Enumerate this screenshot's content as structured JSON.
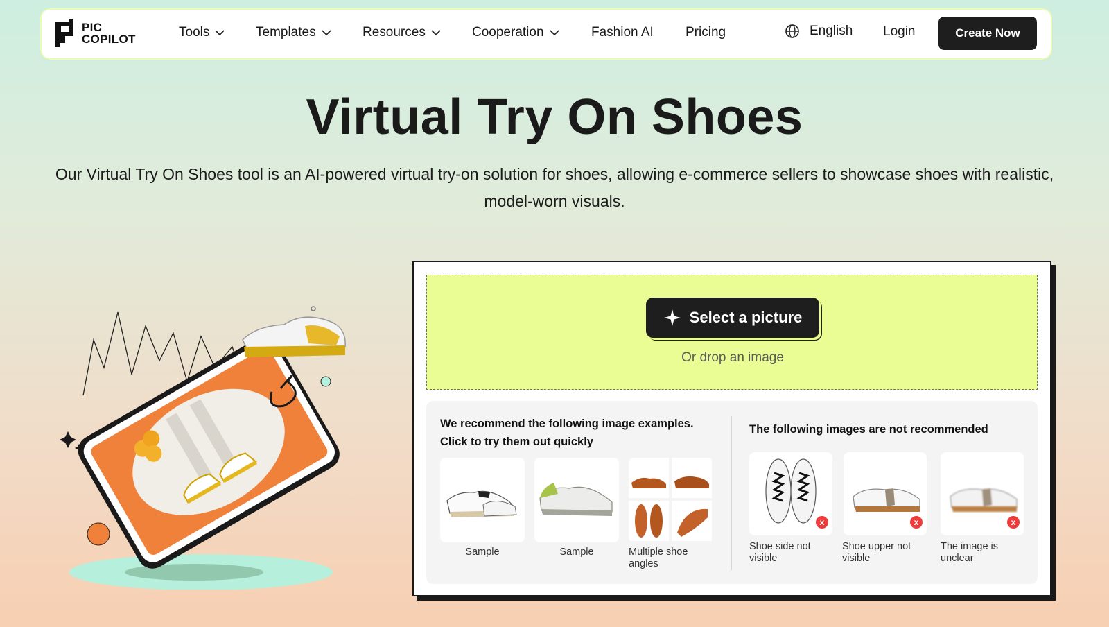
{
  "brand": {
    "line1": "PIC",
    "line2": "COPILOT"
  },
  "nav": {
    "items": [
      {
        "label": "Tools",
        "has_dropdown": true
      },
      {
        "label": "Templates",
        "has_dropdown": true
      },
      {
        "label": "Resources",
        "has_dropdown": true
      },
      {
        "label": "Cooperation",
        "has_dropdown": true
      },
      {
        "label": "Fashion AI",
        "has_dropdown": false
      },
      {
        "label": "Pricing",
        "has_dropdown": false
      }
    ],
    "language": "English",
    "login": "Login",
    "cta": "Create Now"
  },
  "hero": {
    "title": "Virtual Try On Shoes",
    "subtitle": "Our Virtual Try On Shoes tool is an AI-powered virtual try-on solution for shoes, allowing e-commerce sellers to showcase shoes with realistic, model-worn visuals."
  },
  "upload": {
    "button_label": "Select a picture",
    "drop_text": "Or drop an image"
  },
  "examples": {
    "recommended_heading_line1": "We recommend the following image examples.",
    "recommended_heading_line2": "Click to try them out quickly",
    "recommended": [
      {
        "label": "Sample"
      },
      {
        "label": "Sample"
      },
      {
        "label": "Multiple shoe angles"
      }
    ],
    "not_recommended_heading": "The following images are not recommended",
    "not_recommended": [
      {
        "label": "Shoe side not visible",
        "badge": "x"
      },
      {
        "label": "Shoe upper not visible",
        "badge": "x"
      },
      {
        "label": "The image is unclear",
        "badge": "x"
      }
    ]
  },
  "colors": {
    "accent_lime": "#eafd94",
    "dark": "#1e1e1e",
    "orange": "#f0813a",
    "badge_red": "#ee3b3b"
  }
}
